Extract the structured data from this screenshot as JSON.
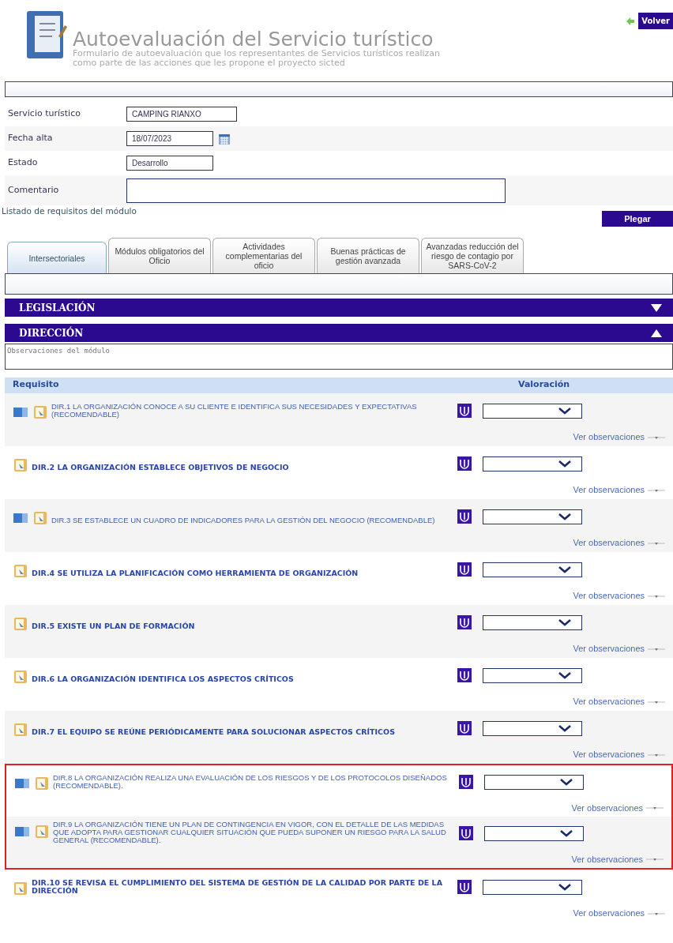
{
  "header": {
    "title": "Autoevaluación del Servicio turístico",
    "subtitle_lines": [
      "Formulario de autoevaluación que los representantes de Servicios turísticos realizan",
      "como parte de las acciones que les propone el proyecto sicted"
    ],
    "back_button": "Volver"
  },
  "form": [
    {
      "label": "Servicio turístico",
      "value": "CAMPING RIANXO",
      "kind": "text"
    },
    {
      "label": "Fecha alta",
      "value": "18/07/2023",
      "kind": "date"
    },
    {
      "label": "Estado",
      "value": "Desarrollo",
      "kind": "text"
    },
    {
      "label": "Comentario",
      "kind": "textarea"
    }
  ],
  "list_title": "Listado de requisitos del módulo",
  "collapse_button": "Plegar",
  "tabs": [
    {
      "label": "Intersectoriales",
      "selected": true
    },
    {
      "label": "Módulos obligatorios del Oficio",
      "selected": false
    },
    {
      "label": "Actividades complementarias del oficio",
      "selected": false
    },
    {
      "label": "Buenas prácticas de gestión avanzada",
      "selected": false
    },
    {
      "label": "Avanzadas reducción del riesgo de contagio por SARS-CoV-2",
      "selected": false
    }
  ],
  "sections": [
    {
      "title": "LEGISLACIÓN",
      "expanded": false
    },
    {
      "title": "DIRECCIÓN",
      "expanded": true
    }
  ],
  "module_notes": {
    "placeholder": "Observaciones del módulo"
  },
  "columns": [
    "Requisito",
    "Valoración"
  ],
  "requirements": [
    {
      "text": "DIR.1 LA ORGANIZACIÓN CONOCE A SU CLIENTE E IDENTIFICA SUS NECESIDADES Y EXPECTATIVAS (RECOMENDABLE)",
      "kind": "recommended",
      "highlighted": false,
      "link": "Ver observaciones"
    },
    {
      "text": "DIR.2 LA ORGANIZACIÓN ESTABLECE OBJETIVOS DE NEGOCIO",
      "kind": "mandatory",
      "highlighted": false,
      "link": "Ver observaciones"
    },
    {
      "text": "DIR.3 SE ESTABLECE UN CUADRO DE INDICADORES PARA LA GESTIÓN DEL NEGOCIO (RECOMENDABLE)",
      "kind": "recommended",
      "highlighted": false,
      "link": "Ver observaciones"
    },
    {
      "text": "DIR.4 SE UTILIZA LA PLANIFICACIÓN COMO HERRAMIENTA DE ORGANIZACIÓN",
      "kind": "mandatory",
      "highlighted": false,
      "link": "Ver observaciones"
    },
    {
      "text": "DIR.5 EXISTE UN PLAN DE FORMACIÓN",
      "kind": "mandatory",
      "highlighted": false,
      "link": "Ver observaciones"
    },
    {
      "text": "DIR.6 LA ORGANIZACIÓN IDENTIFICA LOS ASPECTOS CRÍTICOS",
      "kind": "mandatory",
      "highlighted": false,
      "link": "Ver observaciones"
    },
    {
      "text": "DIR.7 EL EQUIPO SE REÚNE PERIÓDICAMENTE PARA SOLUCIONAR ASPECTOS CRÍTICOS",
      "kind": "mandatory",
      "highlighted": false,
      "link": "Ver observaciones"
    },
    {
      "text": "DIR.8 LA ORGANIZACIÓN REALIZA UNA EVALUACIÓN DE LOS RIESGOS Y DE LOS PROTOCOLOS DISEÑADOS (RECOMENDABLE).",
      "kind": "recommended",
      "highlighted": true,
      "link": "Ver observaciones"
    },
    {
      "text": "DIR.9 LA ORGANIZACIÓN TIENE UN PLAN DE CONTINGENCIA EN VIGOR, CON EL DETALLE DE LAS MEDIDAS QUE ADOPTA PARA GESTIONAR CUALQUIER SITUACIÓN QUE PUEDA SUPONER UN RIESGO PARA LA SALUD GENERAL (RECOMENDABLE).",
      "kind": "recommended",
      "highlighted": true,
      "link": "Ver observaciones"
    },
    {
      "text": "DIR.10 SE REVISA EL CUMPLIMIENTO DEL SISTEMA DE GESTIÓN DE LA CALIDAD POR PARTE DE LA DIRECCIÓN",
      "kind": "mandatory",
      "highlighted": false,
      "link": "Ver observaciones"
    }
  ]
}
